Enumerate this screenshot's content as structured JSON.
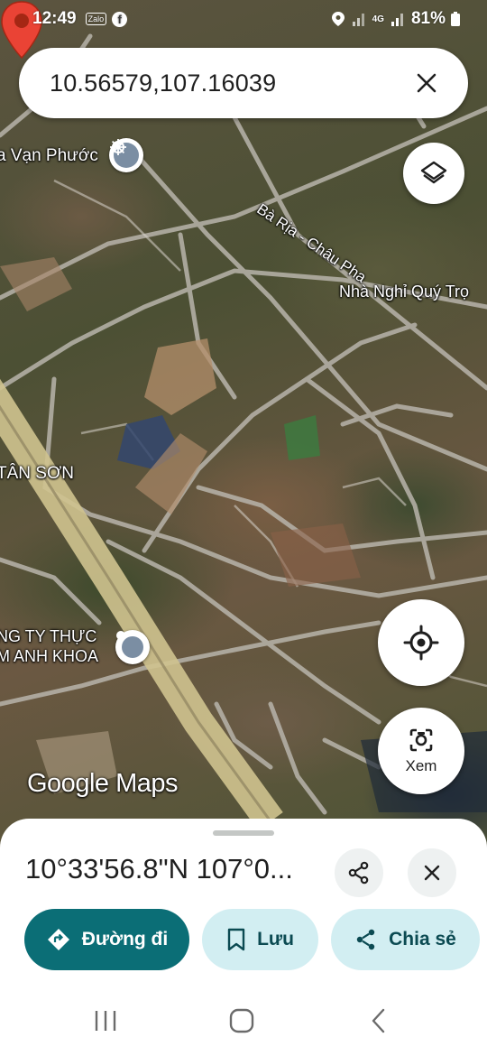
{
  "status_bar": {
    "time": "12:49",
    "zalo_label": "Zalo",
    "facebook_glyph": "f",
    "network": "4G",
    "battery": "81%"
  },
  "search": {
    "query": "10.56579,107.16039"
  },
  "map": {
    "labels": {
      "temple": "a Vạn Phước",
      "road": "Bà Rịa - Châu Pha",
      "guesthouse": "Nhà Nghỉ Quý Trọ",
      "district": "TÂN SƠN",
      "company_line1": "NG TY THỰC",
      "company_line2": "M ANH KHOA"
    },
    "logo": "Google Maps",
    "pin_color": "#ea4335"
  },
  "buttons": {
    "xem_label": "Xem"
  },
  "sheet": {
    "title": "10°33'56.8\"N 107°0...",
    "actions": {
      "directions": "Đường đi",
      "save": "Lưu",
      "share": "Chia sẻ"
    }
  },
  "colors": {
    "primary": "#0b6e76",
    "tonal": "#d2eef2"
  }
}
